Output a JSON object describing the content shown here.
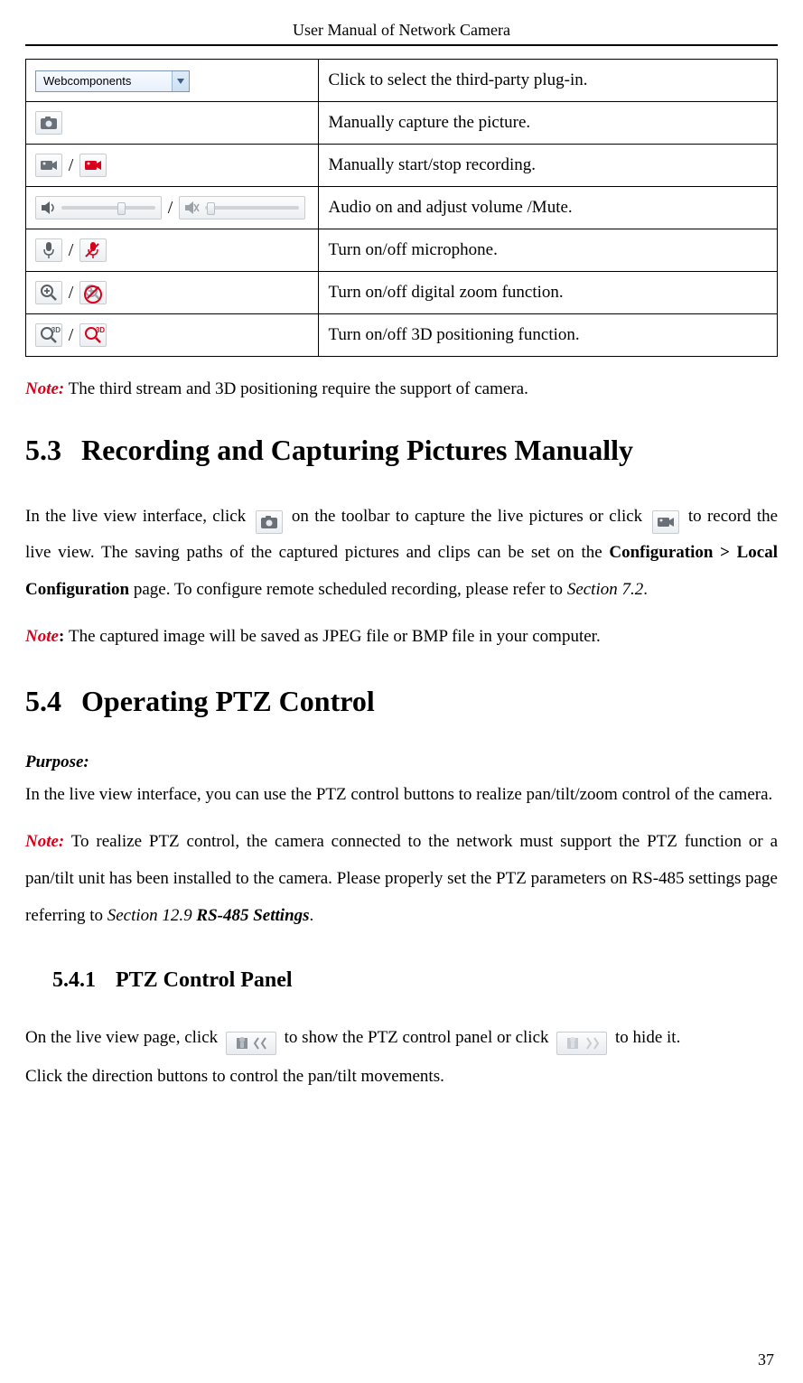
{
  "header": {
    "title": "User Manual of Network Camera"
  },
  "table": {
    "rows": [
      {
        "select_label": "Webcomponents",
        "desc": "Click to select the third-party plug-in."
      },
      {
        "desc": "Manually capture the picture."
      },
      {
        "desc": "Manually start/stop recording."
      },
      {
        "desc": "Audio on and adjust volume /Mute."
      },
      {
        "desc": "Turn on/off microphone."
      },
      {
        "desc": "Turn on/off digital zoom function."
      },
      {
        "desc": "Turn on/off 3D positioning function."
      }
    ]
  },
  "sep_slash": "/",
  "note1": {
    "label": "Note:",
    "text": " The third stream and 3D positioning require the support of camera."
  },
  "sec53": {
    "num": "5.3",
    "title": "Recording and Capturing Pictures Manually",
    "p1a": "In the live view interface, click ",
    "p1b": " on the toolbar to capture the live pictures or click ",
    "p1c": " to record the live view. The saving paths of the captured pictures and clips can be set on the ",
    "conf": "Configuration > Local Configuration",
    "p1d": " page. To configure remote scheduled recording, please refer to ",
    "sec72": "Section 7.2",
    "p1e": ".",
    "note_label": "Note",
    "note_colon": ": ",
    "note_text": "The captured image will be saved as JPEG file or BMP file in your computer."
  },
  "sec54": {
    "num": "5.4",
    "title": "Operating PTZ Control",
    "purpose_label": "Purpose:",
    "p1": "In the live view interface, you can use the PTZ control buttons to realize pan/tilt/zoom control of the camera.",
    "note_label": "Note:",
    "note_text": " To realize PTZ control, the camera connected to the network must support the PTZ function or a pan/tilt unit has been installed to the camera. Please properly set the PTZ parameters on RS-485 settings page referring to ",
    "sec129": "Section 12.9 ",
    "rs485": "RS-485 Settings",
    "p_end": "."
  },
  "sec541": {
    "num": "5.4.1",
    "title": "PTZ Control Panel",
    "p1a": "On the live view page, click ",
    "p1b": " to show the PTZ control panel or click ",
    "p1c": " to hide it.",
    "p2": "Click the direction buttons to control the pan/tilt movements."
  },
  "q3d_label": "3D",
  "page_number": "37"
}
